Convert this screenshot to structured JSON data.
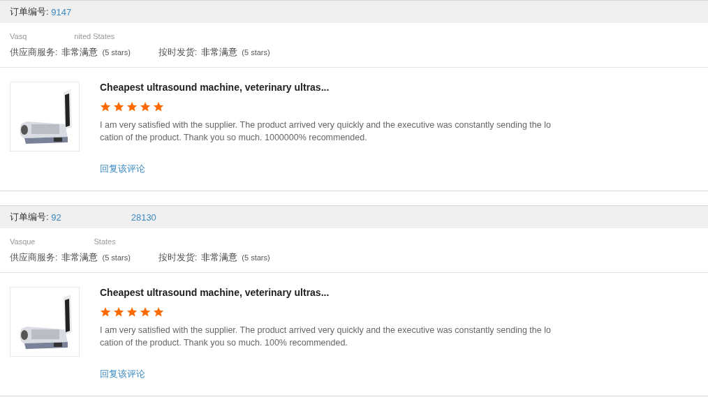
{
  "orders": [
    {
      "order_label": "订单编号:",
      "order_number_parts": [
        "9147"
      ],
      "buyer_parts": [
        "Vasq",
        "nited States"
      ],
      "ratings": [
        {
          "label": "供应商服务:",
          "value": "非常满意",
          "note": "(5 stars)"
        },
        {
          "label": "按时发货:",
          "value": "非常满意",
          "note": "(5 stars)"
        }
      ],
      "product_title": "Cheapest ultrasound machine, veterinary ultras...",
      "stars": 5,
      "comment": "I am very satisfied with the supplier.  The product arrived very quickly and the executive was constantly sending the location of the product.  Thank you so much.  1000000% recommended.",
      "reply_link": "回复该评论"
    },
    {
      "order_label": "订单编号:",
      "order_number_parts": [
        "92",
        "28130"
      ],
      "buyer_parts": [
        "Vasque",
        "States"
      ],
      "ratings": [
        {
          "label": "供应商服务:",
          "value": "非常满意",
          "note": "(5 stars)"
        },
        {
          "label": "按时发货:",
          "value": "非常满意",
          "note": "(5 stars)"
        }
      ],
      "product_title": "Cheapest ultrasound machine, veterinary ultras...",
      "stars": 5,
      "comment": "I am very satisfied with the supplier.  The product arrived very quickly and the executive was constantly sending the location of the product.  Thank you so much.  100% recommended.",
      "reply_link": "回复该评论"
    }
  ]
}
